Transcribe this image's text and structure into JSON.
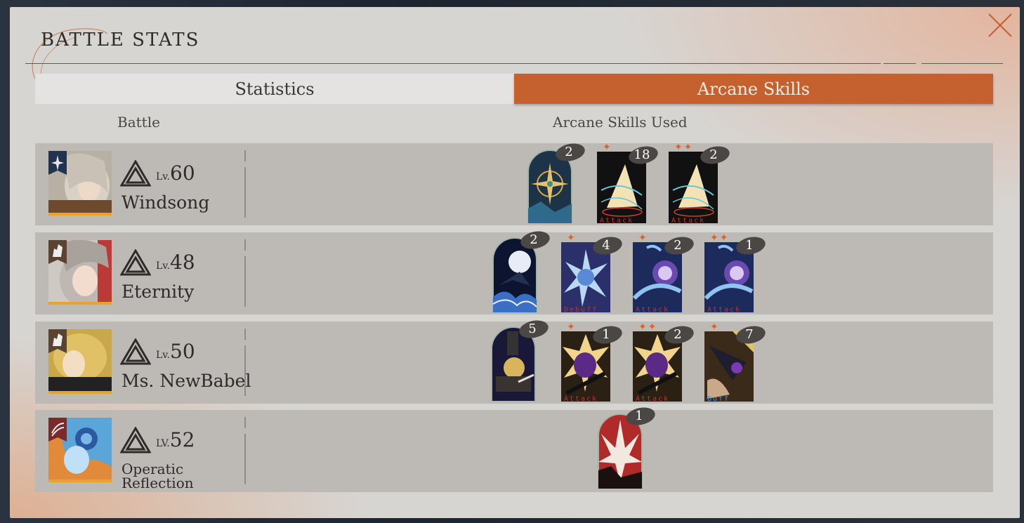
{
  "window": {
    "title": "BATTLE STATS"
  },
  "tabs": {
    "statistics": "Statistics",
    "arcane": "Arcane Skills",
    "active": "arcane"
  },
  "columns": {
    "battle": "Battle",
    "arcane_used": "Arcane Skills Used"
  },
  "colors": {
    "accent": "#c4612f",
    "panel": "#d7d5d2",
    "row": "#bdbab6",
    "star": "#d4642c"
  },
  "rows": [
    {
      "name": "Windsong",
      "lv_label": "Lv.",
      "level": "60",
      "cards": [
        {
          "count": "2",
          "stars": "",
          "label": ""
        },
        {
          "count": "18",
          "stars": "✦",
          "label": "Attack"
        },
        {
          "count": "2",
          "stars": "✦✦",
          "label": "Attack"
        }
      ]
    },
    {
      "name": "Eternity",
      "lv_label": "Lv.",
      "level": "48",
      "cards": [
        {
          "count": "2",
          "stars": "",
          "label": ""
        },
        {
          "count": "4",
          "stars": "✦",
          "label": "Debuff"
        },
        {
          "count": "2",
          "stars": "✦",
          "label": "Attack"
        },
        {
          "count": "1",
          "stars": "✦✦",
          "label": "Attack"
        }
      ]
    },
    {
      "name": "Ms. NewBabel",
      "lv_label": "Lv.",
      "level": "50",
      "cards": [
        {
          "count": "5",
          "stars": "",
          "label": ""
        },
        {
          "count": "1",
          "stars": "✦",
          "label": "Attack"
        },
        {
          "count": "2",
          "stars": "✦✦",
          "label": "Attack"
        },
        {
          "count": "7",
          "stars": "✦",
          "label": "Buff"
        }
      ]
    },
    {
      "name": "Operatic Reflection",
      "lv_label": "LV.",
      "level": "52",
      "cards": [
        {
          "count": "1",
          "stars": "",
          "label": ""
        }
      ]
    }
  ]
}
